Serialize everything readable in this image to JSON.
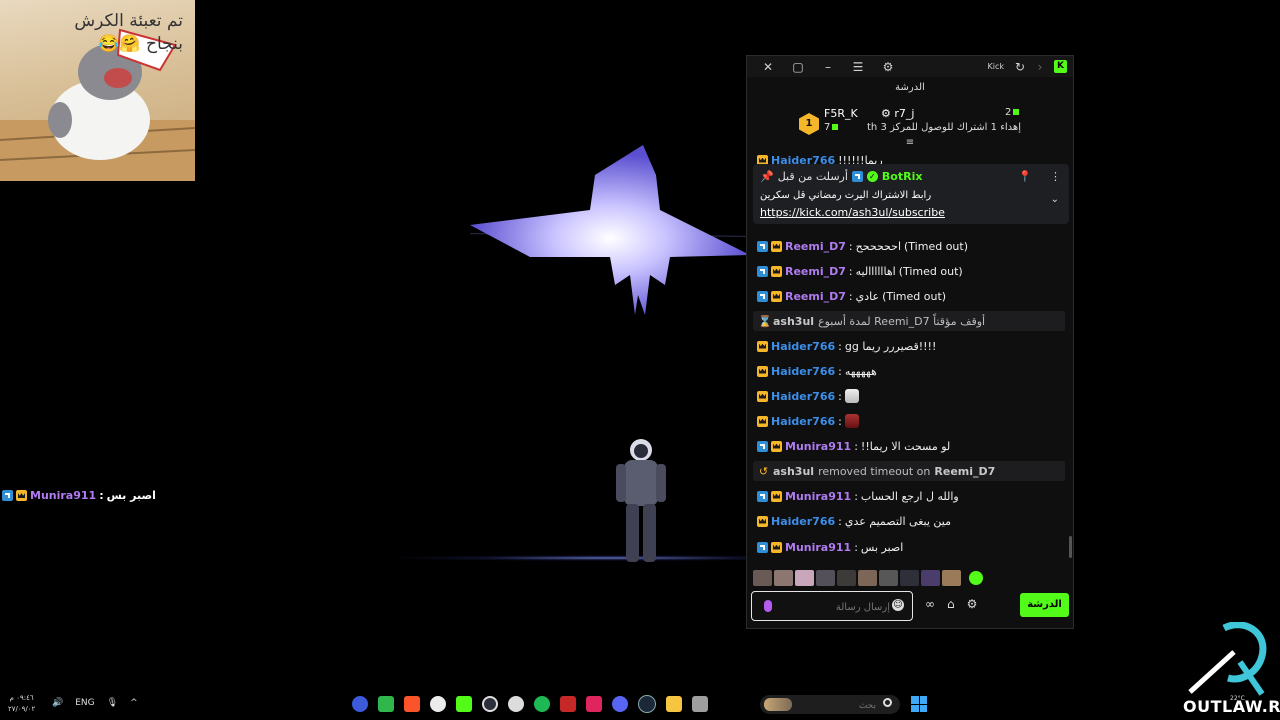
{
  "meme": {
    "caption_line1": "تم تعبئة الكرش",
    "caption_line2": "بنجاح 🤗😂"
  },
  "overlay_chat": {
    "username": "Munira911",
    "separator": ":",
    "message": "اصبر بس"
  },
  "chat_window": {
    "title": "الدرشة",
    "app_label": "Kick",
    "titlebar_icons": [
      "close-icon",
      "maximize-icon",
      "minimize-icon",
      "menu-icon",
      "popout-icon",
      "refresh-icon",
      "forward-icon",
      "kick-logo-icon"
    ],
    "leaderboard": {
      "first_rank": "1",
      "first_name": "F5R_K",
      "first_count": "7",
      "second_name": "r7_j",
      "second_count": "2",
      "goal_text": "إهداء 1 اشتراك للوصول للمركز 3 th"
    },
    "pinned": {
      "author": "BotRix",
      "sent_label": "أرسلت من قبل",
      "message": "رابط الاشتراك اليرت رمضاني قل سكرين",
      "link": "https://kick.com/ash3ul/subscribe"
    },
    "messages": [
      {
        "user": "Haider766",
        "text": "ريما!!!!!!",
        "color": "blue",
        "badges": [
          "crown"
        ],
        "partial": true
      },
      {
        "user": "Reemi_D7",
        "text": "احححححح",
        "status": "(Timed out)",
        "color": "purple",
        "badges": [
          "mod",
          "crown"
        ]
      },
      {
        "user": "Reemi_D7",
        "text": "اهااااااليه",
        "status": "(Timed out)",
        "color": "purple",
        "badges": [
          "mod",
          "crown"
        ]
      },
      {
        "user": "Reemi_D7",
        "text": "عادي",
        "status": "(Timed out)",
        "color": "purple",
        "badges": [
          "mod",
          "crown"
        ]
      },
      {
        "system": "timeout",
        "actor": "ash3ul",
        "text": "أوقف مؤقتاً Reemi_D7 لمدة أسبوع"
      },
      {
        "user": "Haider766",
        "text": "gg قصيررر ريما!!!!",
        "color": "blue",
        "badges": [
          "crown"
        ]
      },
      {
        "user": "Haider766",
        "text": "هههههه",
        "color": "blue",
        "badges": [
          "crown"
        ]
      },
      {
        "user": "Haider766",
        "text": "",
        "emote": "mask",
        "color": "blue",
        "badges": [
          "crown"
        ]
      },
      {
        "user": "Haider766",
        "text": "",
        "emote": "figure",
        "color": "blue",
        "badges": [
          "crown"
        ]
      },
      {
        "user": "Munira911",
        "text": "لو مسحت الا ريما!!",
        "color": "purple",
        "badges": [
          "mod",
          "crown"
        ]
      },
      {
        "system": "untimeout",
        "actor": "ash3ul",
        "text": "removed timeout on",
        "target": "Reemi_D7"
      },
      {
        "user": "Munira911",
        "text": "والله ل ارجع الحساب",
        "color": "purple",
        "badges": [
          "mod",
          "crown"
        ]
      },
      {
        "user": "Haider766",
        "text": "مين يبغى التصميم عدي",
        "color": "blue",
        "badges": [
          "crown"
        ]
      },
      {
        "user": "Munira911",
        "text": "اصبر بس",
        "color": "purple",
        "badges": [
          "mod",
          "crown"
        ]
      }
    ],
    "composer": {
      "placeholder": "إرسال رسالة",
      "send_label": "الدرشة"
    },
    "colors": {
      "kick_green": "#53fc18",
      "mod_blue": "#2f8fd6",
      "crown_gold": "#f6b62a",
      "user_purple": "#b07cf0",
      "user_blue": "#3c8ee8"
    }
  },
  "taskbar": {
    "time": "٠٩:٤٦ م",
    "date": "٢٧/٠٩/٠٢",
    "language": "ENG",
    "search_placeholder": "بحث",
    "app_icons": [
      "app-r-icon",
      "app-green-icon",
      "brave-icon",
      "chatgpt-icon",
      "kick-icon",
      "speedometer-icon",
      "steam-settings-icon",
      "spotify-icon",
      "app-red-icon",
      "adobe-icon",
      "discord-icon",
      "steam-icon",
      "file-explorer-icon",
      "window-icon"
    ]
  },
  "watermark": {
    "brand": "OUTLAW.RP",
    "weather": "22°C"
  }
}
